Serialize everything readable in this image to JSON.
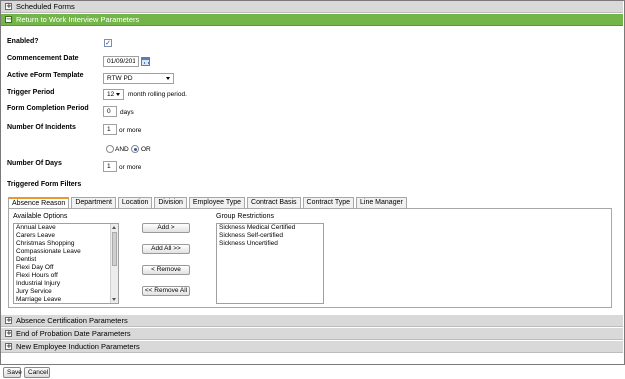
{
  "sections": {
    "scheduled_forms": "Scheduled Forms",
    "rtw_params": "Return to Work Interview Parameters",
    "absence_cert": "Absence Certification Parameters",
    "end_probation": "End of Probation Date Parameters",
    "new_employee": "New Employee Induction Parameters"
  },
  "toggles": {
    "expand": "+",
    "collapse": "−"
  },
  "form": {
    "enabled_label": "Enabled?",
    "enabled_checked": true,
    "commencement_label": "Commencement Date",
    "commencement_value": "01/09/2011",
    "template_label": "Active eForm Template",
    "template_value": "RTW PD",
    "trigger_label": "Trigger Period",
    "trigger_value": "12",
    "trigger_suffix": "month rolling period.",
    "completion_label": "Form Completion Period",
    "completion_value": "0",
    "completion_suffix": "days",
    "incidents_label": "Number Of Incidents",
    "incidents_value": "1",
    "incidents_suffix": "or more",
    "and_label": "AND",
    "or_label": "OR",
    "logic_selected": "OR",
    "days_label": "Number Of Days",
    "days_value": "1",
    "days_suffix": "or more",
    "filters_label": "Triggered Form Filters"
  },
  "tabs": [
    "Absence Reason",
    "Department",
    "Location",
    "Division",
    "Employee Type",
    "Contract Basis",
    "Contract Type",
    "Line Manager"
  ],
  "panel": {
    "available_label": "Available Options",
    "available_options": [
      "Annual Leave",
      "Carers Leave",
      "Christmas Shopping",
      "Compassionate Leave",
      "Dentist",
      "Flexi Day Off",
      "Flexi Hours off",
      "Industrial Injury",
      "Jury Service",
      "Marriage Leave"
    ],
    "group_label": "Group Restrictions",
    "group_options": [
      "Sickness Medical Certified",
      "Sickness Self-certified",
      "Sickness Uncertified"
    ],
    "add": "Add >",
    "add_all": "Add All >>",
    "remove": "< Remove",
    "remove_all": "<< Remove All"
  },
  "footer": {
    "save": "Save",
    "cancel": "Cancel"
  },
  "colors": {
    "active_header": "#74b54a",
    "inactive_header": "#d9d9d9",
    "active_tab_accent": "#e59a2f"
  }
}
